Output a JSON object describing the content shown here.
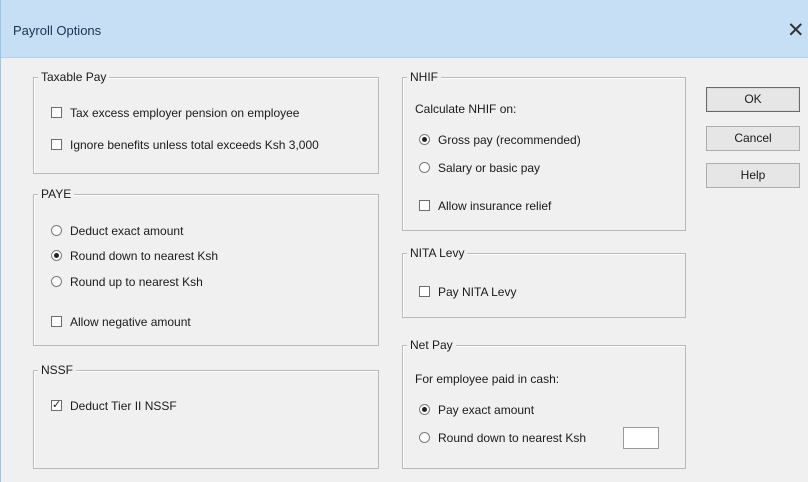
{
  "window": {
    "title": "Payroll Options",
    "close_glyph": "✕"
  },
  "taxable_pay": {
    "legend": "Taxable Pay",
    "options": [
      {
        "label": "Tax excess employer pension on employee",
        "checked": false
      },
      {
        "label": "Ignore benefits unless total exceeds Ksh 3,000",
        "checked": false
      }
    ]
  },
  "paye": {
    "legend": "PAYE",
    "radios": [
      {
        "label": "Deduct exact amount",
        "selected": false
      },
      {
        "label": "Round down to nearest Ksh",
        "selected": true
      },
      {
        "label": "Round up to nearest Ksh",
        "selected": false
      }
    ],
    "allow_negative": {
      "label": "Allow negative amount",
      "checked": false
    }
  },
  "nssf": {
    "legend": "NSSF",
    "tier2": {
      "label": "Deduct Tier II NSSF",
      "checked": true
    }
  },
  "nhif": {
    "legend": "NHIF",
    "caption": "Calculate NHIF on:",
    "radios": [
      {
        "label": "Gross pay (recommended)",
        "selected": true
      },
      {
        "label": "Salary or basic pay",
        "selected": false
      }
    ],
    "insurance_relief": {
      "label": "Allow insurance relief",
      "checked": false
    }
  },
  "nita": {
    "legend": "NITA Levy",
    "pay": {
      "label": "Pay NITA Levy",
      "checked": false
    }
  },
  "net_pay": {
    "legend": "Net Pay",
    "caption": "For employee paid in cash:",
    "radios": [
      {
        "label": "Pay exact amount",
        "selected": true
      },
      {
        "label": "Round down to nearest Ksh",
        "selected": false
      }
    ],
    "round_value": ""
  },
  "buttons": {
    "ok": "OK",
    "cancel": "Cancel",
    "help": "Help"
  }
}
